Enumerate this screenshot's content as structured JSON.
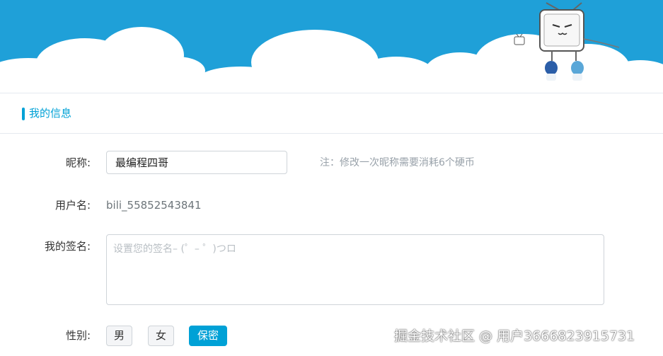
{
  "banner": {
    "colors": {
      "sky": "#1fa0d8",
      "cloud": "#ffffff"
    },
    "mascot": "bilibili-tv-mascot"
  },
  "section": {
    "title": "我的信息",
    "accent": "#00a1d6"
  },
  "form": {
    "nickname": {
      "label": "昵称:",
      "value": "最编程四哥",
      "note": "注：修改一次昵称需要消耗6个硬币"
    },
    "username": {
      "label": "用户名:",
      "value": "bili_55852543841"
    },
    "signature": {
      "label": "我的签名:",
      "placeholder": "设置您的签名– (゜– ゜)つロ",
      "value": ""
    },
    "gender": {
      "label": "性别:",
      "options": [
        "男",
        "女",
        "保密"
      ],
      "selected": "保密"
    }
  },
  "watermark": "掘金技术社区 @ 用户3666823915731"
}
